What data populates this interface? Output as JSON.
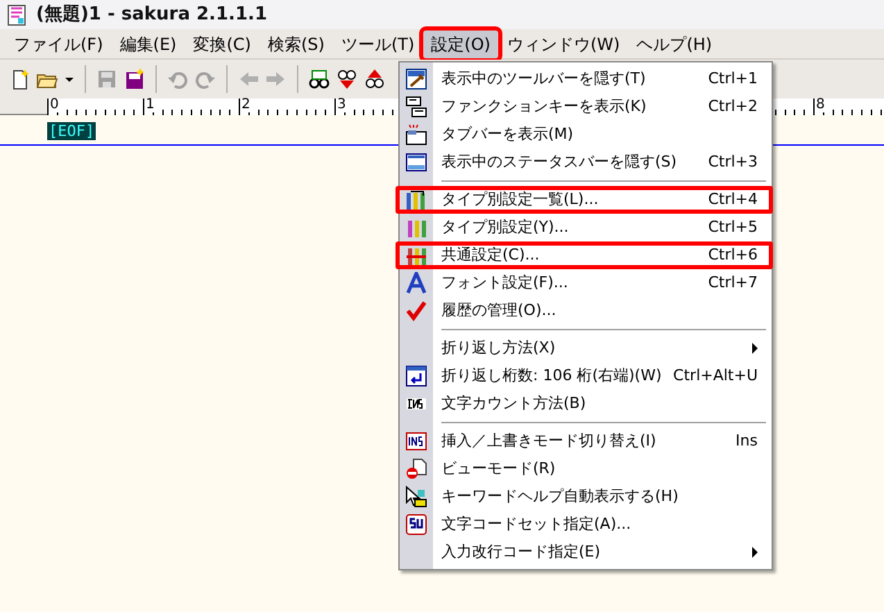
{
  "window": {
    "title": "(無題)1 - sakura 2.1.1.1"
  },
  "menu_bar": [
    {
      "label": "ファイル(F)",
      "selected": false,
      "annotated": false
    },
    {
      "label": "編集(E)",
      "selected": false,
      "annotated": false
    },
    {
      "label": "変換(C)",
      "selected": false,
      "annotated": false
    },
    {
      "label": "検索(S)",
      "selected": false,
      "annotated": false
    },
    {
      "label": "ツール(T)",
      "selected": false,
      "annotated": false
    },
    {
      "label": "設定(O)",
      "selected": true,
      "annotated": true
    },
    {
      "label": "ウィンドウ(W)",
      "selected": false,
      "annotated": false
    },
    {
      "label": "ヘルプ(H)",
      "selected": false,
      "annotated": false
    }
  ],
  "ruler": {
    "labels": [
      "0",
      "1",
      "2",
      "3",
      "8"
    ]
  },
  "editor": {
    "eof_marker": "[EOF]"
  },
  "menu": [
    {
      "kind": "item",
      "label": "表示中のツールバーを隠す(T)",
      "shortcut": "Ctrl+1",
      "annotated": false
    },
    {
      "kind": "item",
      "label": "ファンクションキーを表示(K)",
      "shortcut": "Ctrl+2",
      "annotated": false
    },
    {
      "kind": "item",
      "label": "タブバーを表示(M)",
      "annotated": false
    },
    {
      "kind": "item",
      "label": "表示中のステータスバーを隠す(S)",
      "shortcut": "Ctrl+3",
      "annotated": false
    },
    {
      "kind": "separator"
    },
    {
      "kind": "item",
      "label": "タイプ別設定一覧(L)...",
      "shortcut": "Ctrl+4",
      "annotated": true
    },
    {
      "kind": "item",
      "label": "タイプ別設定(Y)...",
      "shortcut": "Ctrl+5",
      "annotated": false
    },
    {
      "kind": "item",
      "label": "共通設定(C)...",
      "shortcut": "Ctrl+6",
      "annotated": true
    },
    {
      "kind": "item",
      "label": "フォント設定(F)...",
      "shortcut": "Ctrl+7",
      "annotated": false
    },
    {
      "kind": "item",
      "label": "履歴の管理(O)...",
      "annotated": false
    },
    {
      "kind": "separator"
    },
    {
      "kind": "submenu",
      "label": "折り返し方法(X)",
      "annotated": false
    },
    {
      "kind": "item",
      "label": "折り返し桁数: 106 桁(右端)(W)",
      "shortcut": "Ctrl+Alt+U",
      "annotated": false
    },
    {
      "kind": "item",
      "label": "文字カウント方法(B)",
      "annotated": false
    },
    {
      "kind": "separator"
    },
    {
      "kind": "item",
      "label": "挿入／上書きモード切り替え(I)",
      "shortcut": "Ins",
      "annotated": false
    },
    {
      "kind": "item",
      "label": "ビューモード(R)",
      "annotated": false
    },
    {
      "kind": "item",
      "label": "キーワードヘルプ自動表示する(H)",
      "annotated": false
    },
    {
      "kind": "item",
      "label": "文字コードセット指定(A)...",
      "annotated": false
    },
    {
      "kind": "submenu",
      "label": "入力改行コード指定(E)",
      "annotated": false
    }
  ]
}
